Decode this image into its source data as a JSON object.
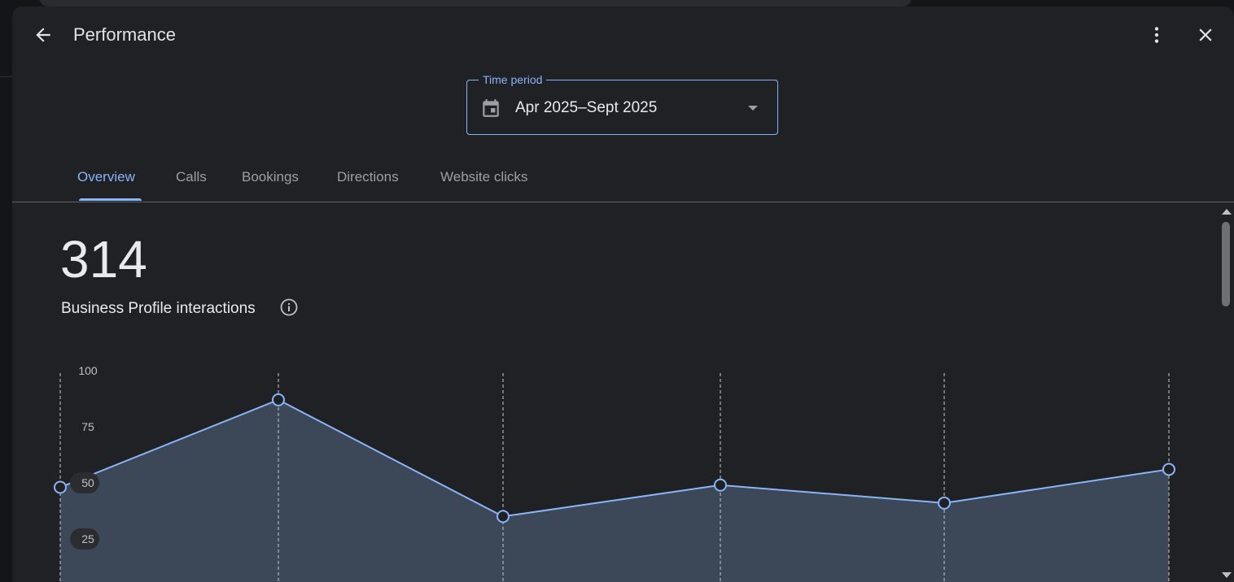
{
  "dialog": {
    "title": "Performance",
    "back_icon": "arrow-back-icon",
    "more_icon": "more-vert-icon",
    "close_icon": "close-icon"
  },
  "time_period": {
    "label": "Time period",
    "value": "Apr 2025–Sept 2025",
    "calendar_icon": "calendar-icon",
    "dropdown_icon": "arrow-drop-down-icon"
  },
  "tabs": [
    {
      "label": "Overview",
      "active": true
    },
    {
      "label": "Calls",
      "active": false
    },
    {
      "label": "Bookings",
      "active": false
    },
    {
      "label": "Directions",
      "active": false
    },
    {
      "label": "Website clicks",
      "active": false
    }
  ],
  "summary": {
    "total": "314",
    "label": "Business Profile interactions",
    "info_icon": "info-icon"
  },
  "colors": {
    "accent": "#8ab4f8",
    "background": "#202124",
    "area_fill": "#3c4758"
  },
  "chart_data": {
    "type": "area",
    "x": [
      0,
      1,
      2,
      3,
      4,
      5
    ],
    "values": [
      48,
      87,
      35,
      49,
      41,
      56
    ],
    "y_ticks": [
      "100",
      "75",
      "50",
      "25"
    ],
    "ylim": [
      0,
      100
    ],
    "grid": "vertical-dashed"
  }
}
